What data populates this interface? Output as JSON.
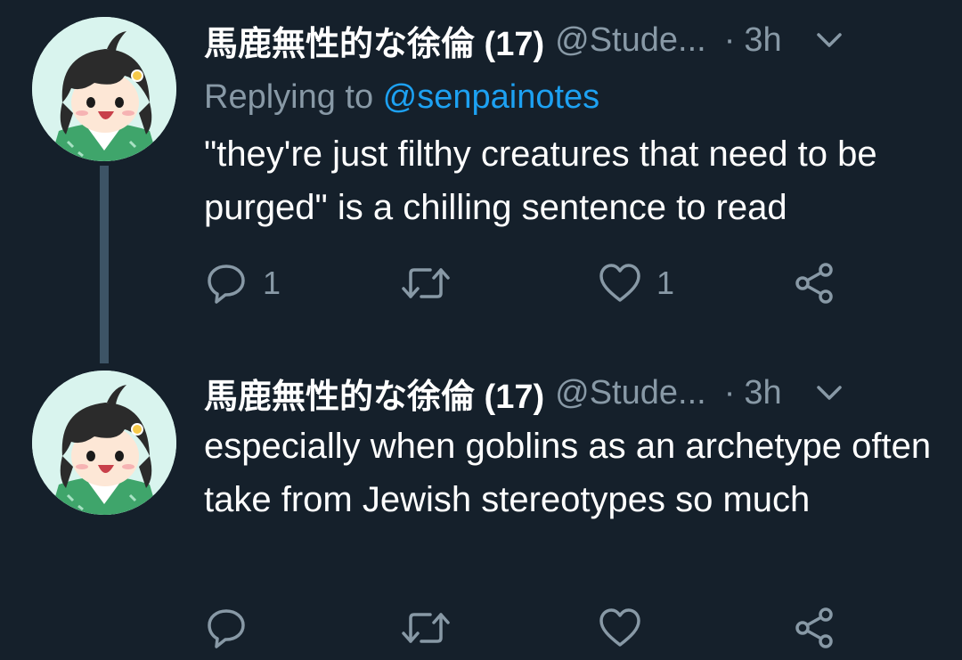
{
  "tweets": [
    {
      "display_name": "馬鹿無性的な徐倫 (17)",
      "handle": "@Stude...",
      "separator": "·",
      "time": "3h",
      "replying_prefix": "Replying to ",
      "replying_to": "@senpainotes",
      "text": "\"they're just filthy creatures that need to be purged\" is a chilling sentence to read",
      "reply_count": "1",
      "retweet_count": "",
      "like_count": "1"
    },
    {
      "display_name": "馬鹿無性的な徐倫 (17)",
      "handle": "@Stude...",
      "separator": "·",
      "time": "3h",
      "text": "especially when goblins as an archetype often take from Jewish stereotypes so much",
      "reply_count": "",
      "retweet_count": "",
      "like_count": ""
    }
  ],
  "icons": {
    "reply": "reply-icon",
    "retweet": "retweet-icon",
    "like": "like-icon",
    "share": "share-icon",
    "menu": "chevron-down-icon"
  },
  "colors": {
    "background": "#15202b",
    "secondary_text": "#8899a6",
    "link": "#1da1f2",
    "thread_line": "#3d5466"
  }
}
